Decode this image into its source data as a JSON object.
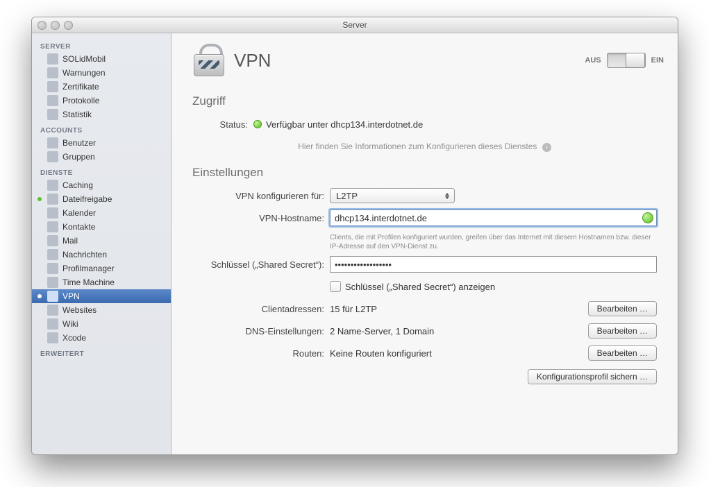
{
  "window": {
    "title": "Server"
  },
  "toggle": {
    "off": "AUS",
    "on": "EIN"
  },
  "page_title": "VPN",
  "sidebar": {
    "groups": [
      {
        "label": "SERVER",
        "items": [
          {
            "label": "SOLidMobil"
          },
          {
            "label": "Warnungen"
          },
          {
            "label": "Zertifikate"
          },
          {
            "label": "Protokolle"
          },
          {
            "label": "Statistik"
          }
        ]
      },
      {
        "label": "ACCOUNTS",
        "items": [
          {
            "label": "Benutzer"
          },
          {
            "label": "Gruppen"
          }
        ]
      },
      {
        "label": "DIENSTE",
        "items": [
          {
            "label": "Caching"
          },
          {
            "label": "Dateifreigabe"
          },
          {
            "label": "Kalender"
          },
          {
            "label": "Kontakte"
          },
          {
            "label": "Mail"
          },
          {
            "label": "Nachrichten"
          },
          {
            "label": "Profilmanager"
          },
          {
            "label": "Time Machine"
          },
          {
            "label": "VPN"
          },
          {
            "label": "Websites"
          },
          {
            "label": "Wiki"
          },
          {
            "label": "Xcode"
          }
        ]
      },
      {
        "label": "ERWEITERT",
        "items": []
      }
    ]
  },
  "access": {
    "heading": "Zugriff",
    "status_label": "Status:",
    "status_text": "Verfügbar unter dhcp134.interdotnet.de",
    "info_line": "Hier finden Sie Informationen zum Konfigurieren dieses Dienstes"
  },
  "settings": {
    "heading": "Einstellungen",
    "configure_label": "VPN konfigurieren für:",
    "configure_value": "L2TP",
    "hostname_label": "VPN-Hostname:",
    "hostname_value": "dhcp134.interdotnet.de",
    "hostname_hint": "Clients, die mit Profilen konfiguriert wurden, greifen über das Internet mit diesem Hostnamen bzw. dieser IP-Adresse auf den VPN-Dienst zu.",
    "secret_label": "Schlüssel („Shared Secret“):",
    "secret_value": "••••••••••••••••••",
    "show_secret_label": "Schlüssel („Shared Secret“) anzeigen",
    "client_addr_label": "Clientadressen:",
    "client_addr_value": "15 für L2TP",
    "dns_label": "DNS-Einstellungen:",
    "dns_value": "2 Name-Server, 1 Domain",
    "routes_label": "Routen:",
    "routes_value": "Keine Routen konfiguriert",
    "edit_button": "Bearbeiten …",
    "save_profile_button": "Konfigurationsprofil sichern …"
  }
}
